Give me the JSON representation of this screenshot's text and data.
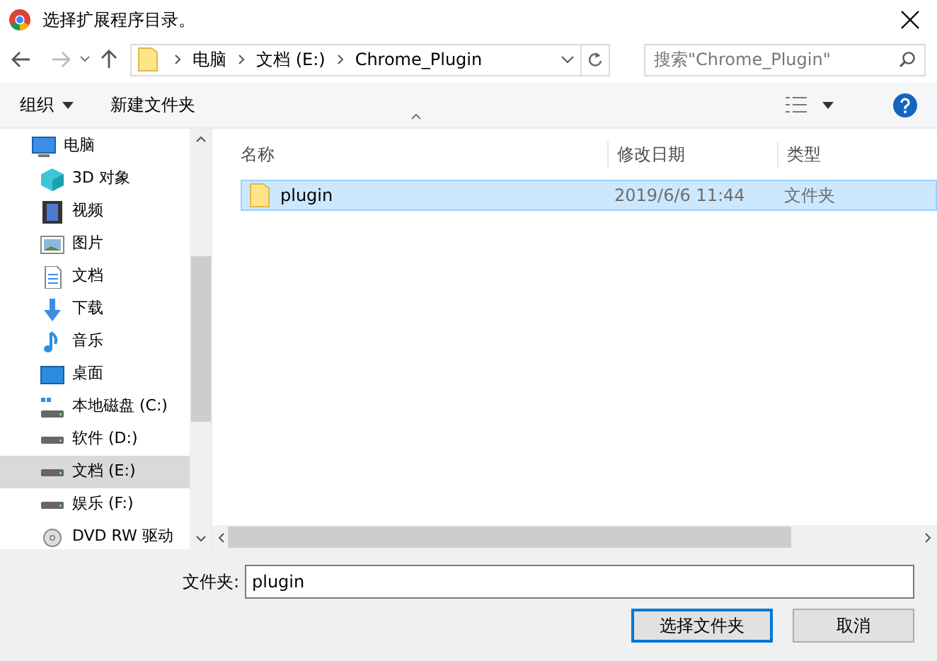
{
  "window": {
    "title": "选择扩展程序目录。"
  },
  "address_bar": {
    "crumbs": [
      "电脑",
      "文档 (E:)",
      "Chrome_Plugin"
    ]
  },
  "search": {
    "placeholder": "搜索\"Chrome_Plugin\""
  },
  "toolbar": {
    "organize": "组织",
    "new_folder": "新建文件夹"
  },
  "sidebar": {
    "items": [
      {
        "label": "电脑",
        "kind": "pc",
        "selected": false,
        "children": [
          {
            "label": "3D 对象",
            "kind": "cube",
            "selected": false
          },
          {
            "label": "视频",
            "kind": "video",
            "selected": false
          },
          {
            "label": "图片",
            "kind": "picture",
            "selected": false
          },
          {
            "label": "文档",
            "kind": "document",
            "selected": false
          },
          {
            "label": "下载",
            "kind": "download",
            "selected": false
          },
          {
            "label": "音乐",
            "kind": "music",
            "selected": false
          },
          {
            "label": "桌面",
            "kind": "desktop",
            "selected": false
          },
          {
            "label": "本地磁盘 (C:)",
            "kind": "system-drive",
            "selected": false
          },
          {
            "label": "软件 (D:)",
            "kind": "drive",
            "selected": false
          },
          {
            "label": "文档 (E:)",
            "kind": "drive",
            "selected": true
          },
          {
            "label": "娱乐 (F:)",
            "kind": "drive",
            "selected": false
          },
          {
            "label": "DVD RW 驱动",
            "kind": "disc",
            "selected": false
          }
        ]
      }
    ]
  },
  "table": {
    "columns": [
      "名称",
      "修改日期",
      "类型"
    ],
    "rows": [
      {
        "name": "plugin",
        "modified": "2019/6/6 11:44",
        "type": "文件夹",
        "selected": true
      }
    ]
  },
  "footer": {
    "folder_label": "文件夹:",
    "folder_value": "plugin",
    "buttons": [
      {
        "label": "选择文件夹",
        "primary": true
      },
      {
        "label": "取消",
        "primary": false
      }
    ]
  }
}
